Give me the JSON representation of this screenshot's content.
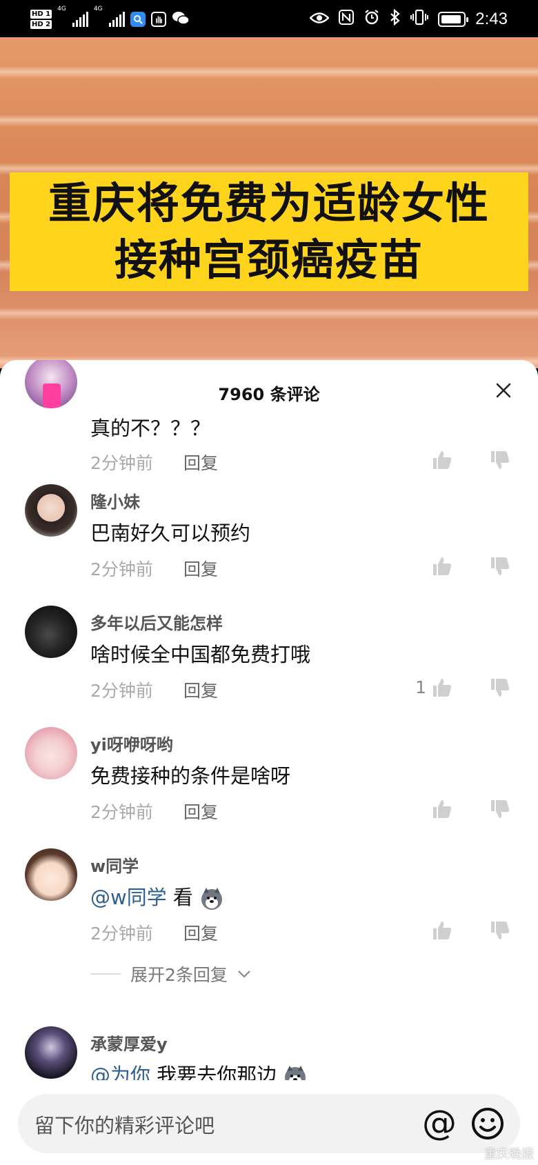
{
  "status_bar": {
    "hd1": "HD 1",
    "hd2": "HD 2",
    "net1": "4G",
    "net2": "4G",
    "time": "2:43",
    "icons": [
      "eye-icon",
      "nfc-icon",
      "alarm-icon",
      "bluetooth-icon",
      "vibrate-icon",
      "battery-icon"
    ]
  },
  "video": {
    "banner_line1": "重庆将免费为适龄女性",
    "banner_line2": "接种宫颈癌疫苗",
    "colors": {
      "banner_bg": "#ffd41c",
      "backdrop": "#d98657"
    }
  },
  "comments_sheet": {
    "title": "7960 条评论",
    "close_label": "×",
    "comments": [
      {
        "username": "",
        "text": "真的不？？？",
        "time": "2分钟前",
        "reply_label": "回复",
        "likes": ""
      },
      {
        "username": "隆小妹",
        "text": "巴南好久可以预约",
        "time": "2分钟前",
        "reply_label": "回复",
        "likes": ""
      },
      {
        "username": "多年以后又能怎样",
        "text": "啥时候全中国都免费打哦",
        "time": "2分钟前",
        "reply_label": "回复",
        "likes": "1"
      },
      {
        "username": "yi呀咿呀哟",
        "text": "免费接种的条件是啥呀",
        "time": "2分钟前",
        "reply_label": "回复",
        "likes": ""
      },
      {
        "username": "w同学",
        "mention": "@w同学",
        "text": " 看",
        "time": "2分钟前",
        "reply_label": "回复",
        "likes": "",
        "expand_label": "展开2条回复"
      },
      {
        "username": "承蒙厚爱y",
        "mention": "@为你",
        "text": " 我要去你那边"
      }
    ]
  },
  "input_bar": {
    "placeholder": "留下你的精彩评论吧",
    "at_label": "@",
    "watermark": "重庆晚报"
  }
}
